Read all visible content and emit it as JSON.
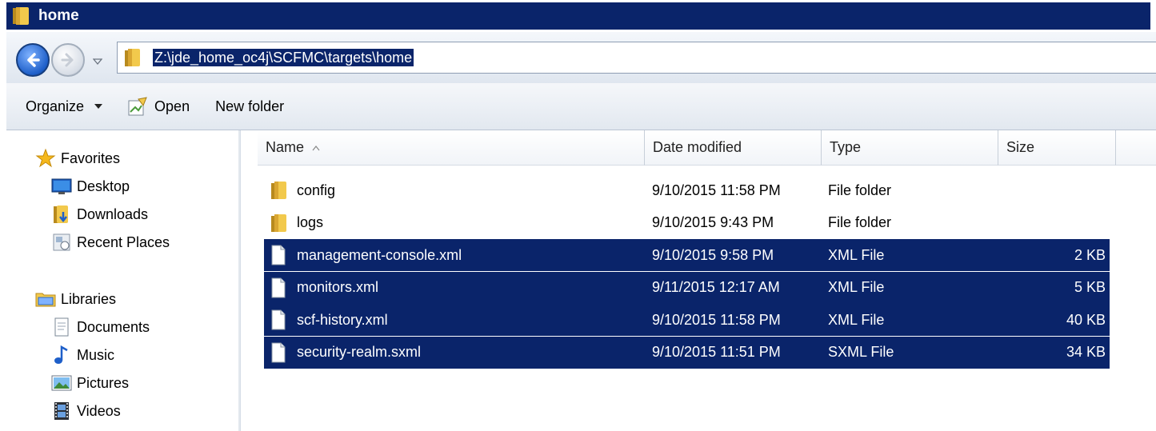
{
  "window": {
    "title": "home"
  },
  "address": {
    "path": "Z:\\jde_home_oc4j\\SCFMC\\targets\\home"
  },
  "toolbar": {
    "organize": "Organize",
    "open": "Open",
    "new_folder": "New folder"
  },
  "sidebar": {
    "favorites": {
      "label": "Favorites",
      "items": [
        {
          "label": "Desktop",
          "icon": "desktop-icon"
        },
        {
          "label": "Downloads",
          "icon": "downloads-icon"
        },
        {
          "label": "Recent Places",
          "icon": "recent-places-icon"
        }
      ]
    },
    "libraries": {
      "label": "Libraries",
      "items": [
        {
          "label": "Documents",
          "icon": "documents-icon"
        },
        {
          "label": "Music",
          "icon": "music-icon"
        },
        {
          "label": "Pictures",
          "icon": "pictures-icon"
        },
        {
          "label": "Videos",
          "icon": "videos-icon"
        }
      ]
    }
  },
  "columns": {
    "name": "Name",
    "date": "Date modified",
    "type": "Type",
    "size": "Size"
  },
  "files": [
    {
      "name": "config",
      "date": "9/10/2015 11:58 PM",
      "type": "File folder",
      "size": "",
      "kind": "folder",
      "selected": false
    },
    {
      "name": "logs",
      "date": "9/10/2015 9:43 PM",
      "type": "File folder",
      "size": "",
      "kind": "folder",
      "selected": false
    },
    {
      "name": "management-console.xml",
      "date": "9/10/2015 9:58 PM",
      "type": "XML File",
      "size": "2 KB",
      "kind": "file",
      "selected": true
    },
    {
      "name": "monitors.xml",
      "date": "9/11/2015 12:17 AM",
      "type": "XML File",
      "size": "5 KB",
      "kind": "file",
      "selected": true
    },
    {
      "name": "scf-history.xml",
      "date": "9/10/2015 11:58 PM",
      "type": "XML File",
      "size": "40 KB",
      "kind": "file",
      "selected": true
    },
    {
      "name": "security-realm.sxml",
      "date": "9/10/2015 11:51 PM",
      "type": "SXML File",
      "size": "34 KB",
      "kind": "file",
      "selected": true
    }
  ],
  "colors": {
    "title_bg": "#0a246a",
    "selection_bg": "#0a246a",
    "folder_yellow": "#e8b93a"
  }
}
